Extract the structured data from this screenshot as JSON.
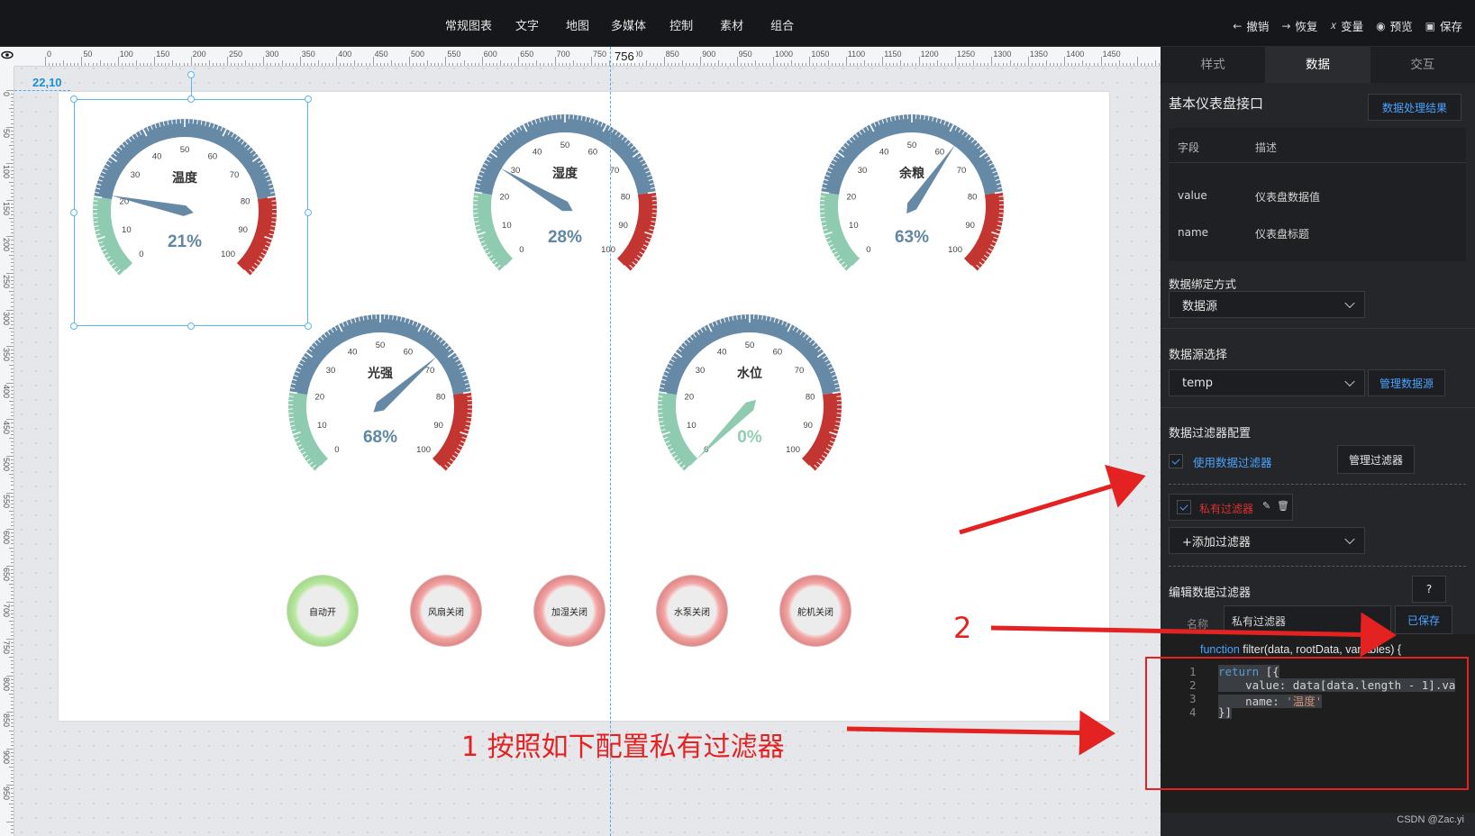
{
  "topbar": {
    "menu": [
      "常规图表",
      "文字",
      "地图",
      "多媒体",
      "控制",
      "素材",
      "组合"
    ],
    "actions": [
      {
        "icon": "arrow-left-icon",
        "label": "撤销"
      },
      {
        "icon": "arrow-right-icon",
        "label": "恢复"
      },
      {
        "icon": "variable-icon",
        "label": "变量"
      },
      {
        "icon": "eye-icon",
        "label": "预览"
      },
      {
        "icon": "save-icon",
        "label": "保存"
      }
    ]
  },
  "canvas": {
    "ruler_h_labels": [
      "0",
      "50",
      "100",
      "150",
      "200",
      "250",
      "300",
      "350",
      "400",
      "450",
      "500",
      "550",
      "600",
      "650",
      "700",
      "750",
      "800",
      "850",
      "900",
      "950",
      "1000",
      "1050",
      "1100",
      "1150",
      "1200",
      "1250",
      "1300",
      "1350",
      "1400",
      "1450"
    ],
    "ruler_v_labels": [
      "0",
      "50",
      "100",
      "150",
      "200",
      "250",
      "300",
      "350",
      "400",
      "450",
      "500",
      "550",
      "600",
      "650",
      "700",
      "750",
      "800",
      "850",
      "900",
      "950"
    ],
    "guide_label": "756",
    "position_label": "22,10"
  },
  "gauges": [
    {
      "title": "温度",
      "value": 21,
      "display": "21%",
      "ticks": [
        "0",
        "10",
        "20",
        "30",
        "40",
        "50",
        "60",
        "70",
        "80",
        "90",
        "100"
      ],
      "value_color": "#5f88a5"
    },
    {
      "title": "湿度",
      "value": 28,
      "display": "28%",
      "ticks": [
        "0",
        "10",
        "20",
        "30",
        "40",
        "50",
        "60",
        "70",
        "80",
        "90",
        "100"
      ],
      "value_color": "#5f88a5"
    },
    {
      "title": "余粮",
      "value": 63,
      "display": "63%",
      "ticks": [
        "0",
        "10",
        "20",
        "30",
        "40",
        "50",
        "60",
        "70",
        "80",
        "90",
        "100"
      ],
      "value_color": "#5f88a5"
    },
    {
      "title": "光强",
      "value": 68,
      "display": "68%",
      "ticks": [
        "0",
        "10",
        "20",
        "30",
        "40",
        "50",
        "60",
        "70",
        "80",
        "90",
        "100"
      ],
      "value_color": "#5f88a5"
    },
    {
      "title": "水位",
      "value": 0,
      "display": "0%",
      "ticks": [
        "0",
        "10",
        "20",
        "30",
        "40",
        "50",
        "60",
        "70",
        "80",
        "90",
        "100"
      ],
      "value_color": "#8fcfb0"
    }
  ],
  "gauge_colors": {
    "low": "#8fcbb0",
    "mid": "#6689a6",
    "high": "#c23531"
  },
  "buttons": [
    {
      "label": "自动开",
      "state": "on"
    },
    {
      "label": "风扇关闭",
      "state": "off"
    },
    {
      "label": "加湿关闭",
      "state": "off"
    },
    {
      "label": "水泵关闭",
      "state": "off"
    },
    {
      "label": "舵机关闭",
      "state": "off"
    }
  ],
  "annotations": {
    "step1": "1  按照如下配置私有过滤器",
    "step2": "2"
  },
  "panel": {
    "tabs": [
      "样式",
      "数据",
      "交互"
    ],
    "active_tab": "数据",
    "title": "基本仪表盘接口",
    "result_button": "数据处理结果",
    "field_header": {
      "field": "字段",
      "desc": "描述"
    },
    "fields": [
      {
        "field": "value",
        "desc": "仪表盘数据值"
      },
      {
        "field": "name",
        "desc": "仪表盘标题"
      }
    ],
    "bind_label": "数据绑定方式",
    "bind_value": "数据源",
    "source_label": "数据源选择",
    "source_value": "temp",
    "manage_source": "管理数据源",
    "filter_config_label": "数据过滤器配置",
    "use_filter": "使用数据过滤器",
    "manage_filter": "管理过滤器",
    "private_filter": "私有过滤器",
    "add_filter": "+添加过滤器",
    "edit_filter_label": "编辑数据过滤器",
    "help": "?",
    "name_label": "名称",
    "name_value": "私有过滤器",
    "saved": "已保存",
    "code_header_kw": "function",
    "code_header_rest": " filter(data, rootData, variables) {",
    "code_lines": [
      "1",
      "2",
      "3",
      "4"
    ],
    "credit": "CSDN @Zac.yi"
  }
}
